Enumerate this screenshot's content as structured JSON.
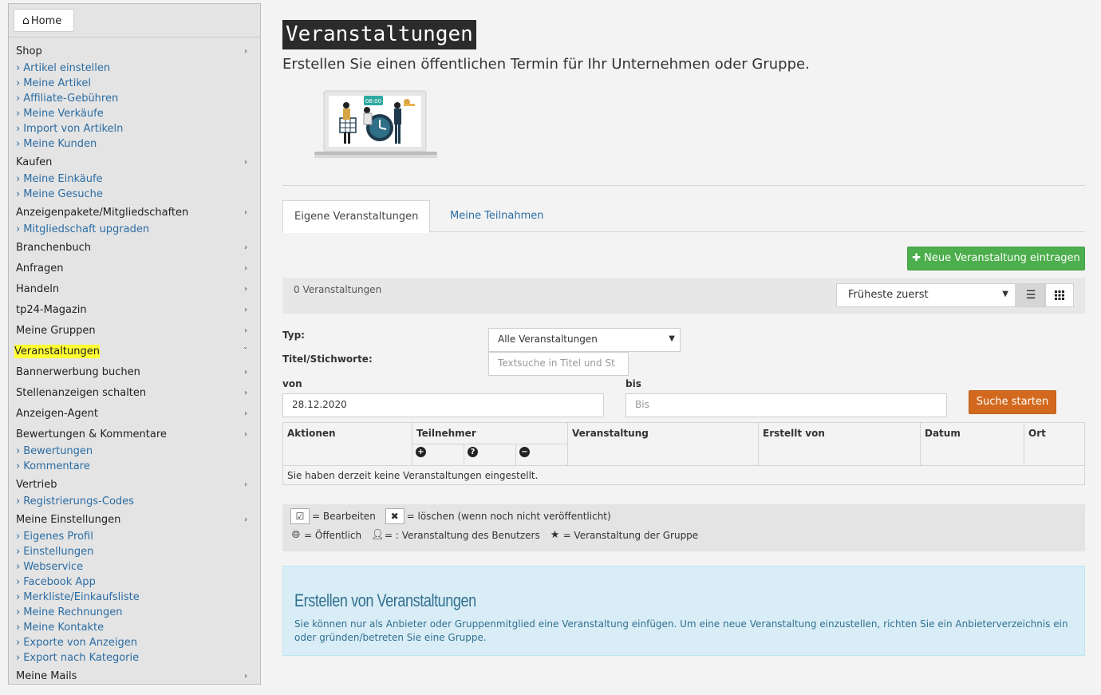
{
  "home": {
    "label": "Home",
    "icon": "home-icon"
  },
  "sidebar": {
    "rows": [
      {
        "type": "top",
        "label": "Shop"
      },
      {
        "type": "sub",
        "label": "Artikel einstellen"
      },
      {
        "type": "sub",
        "label": "Meine Artikel"
      },
      {
        "type": "sub",
        "label": "Affiliate-Gebühren"
      },
      {
        "type": "sub",
        "label": "Meine Verkäufe"
      },
      {
        "type": "sub",
        "label": "Import von Artikeln"
      },
      {
        "type": "sub",
        "label": "Meine Kunden"
      },
      {
        "type": "top",
        "label": "Kaufen"
      },
      {
        "type": "sub",
        "label": "Meine Einkäufe"
      },
      {
        "type": "sub",
        "label": "Meine Gesuche"
      },
      {
        "type": "top",
        "label": "Anzeigenpakete/Mitgliedschaften"
      },
      {
        "type": "sub",
        "label": "Mitgliedschaft upgraden"
      },
      {
        "type": "top",
        "label": "Branchenbuch"
      },
      {
        "type": "top",
        "label": "Anfragen"
      },
      {
        "type": "top",
        "label": "Handeln"
      },
      {
        "type": "top",
        "label": "tp24-Magazin"
      },
      {
        "type": "top",
        "label": "Meine Gruppen"
      },
      {
        "type": "top",
        "label": "Veranstaltungen",
        "active": true
      },
      {
        "type": "top",
        "label": "Bannerwerbung buchen"
      },
      {
        "type": "top",
        "label": "Stellenanzeigen schalten"
      },
      {
        "type": "top",
        "label": "Anzeigen-Agent"
      },
      {
        "type": "top",
        "label": "Bewertungen & Kommentare"
      },
      {
        "type": "sub",
        "label": "Bewertungen"
      },
      {
        "type": "sub",
        "label": "Kommentare"
      },
      {
        "type": "top",
        "label": "Vertrieb"
      },
      {
        "type": "sub",
        "label": "Registrierungs-Codes"
      },
      {
        "type": "top",
        "label": "Meine Einstellungen"
      },
      {
        "type": "sub",
        "label": "Eigenes Profil"
      },
      {
        "type": "sub",
        "label": "Einstellungen"
      },
      {
        "type": "sub",
        "label": "Webservice"
      },
      {
        "type": "sub",
        "label": "Facebook App"
      },
      {
        "type": "sub",
        "label": "Merkliste/Einkaufsliste"
      },
      {
        "type": "sub",
        "label": "Meine Rechnungen"
      },
      {
        "type": "sub",
        "label": "Meine Kontakte"
      },
      {
        "type": "sub",
        "label": "Exporte von Anzeigen"
      },
      {
        "type": "sub",
        "label": "Export nach Kategorie"
      },
      {
        "type": "top",
        "label": "Meine Mails"
      }
    ]
  },
  "page": {
    "title": "Veranstaltungen",
    "subtitle": "Erstellen Sie einen öffentlichen Termin für Ihr Unternehmen oder Gruppe.",
    "illustration_clock": "08:00"
  },
  "tabs": [
    {
      "label": "Eigene Veranstaltungen",
      "active": true
    },
    {
      "label": "Meine Teilnahmen",
      "active": false
    }
  ],
  "toolbar": {
    "new_button": "Neue Veranstaltung eintragen",
    "count": "0 Veranstaltungen",
    "sort_selected": "Früheste zuerst",
    "views": [
      "list-view-icon",
      "grid-view-icon"
    ]
  },
  "filters": {
    "type_label": "Typ:",
    "type_selected": "Alle Veranstaltungen",
    "keywords_label": "Titel/Stichworte:",
    "keywords_placeholder": "Textsuche in Titel und St",
    "from_label": "von",
    "from_value": "28.12.2020",
    "to_label": "bis",
    "to_placeholder": "Bis",
    "search_button": "Suche starten"
  },
  "table": {
    "columns": [
      "Aktionen",
      "Teilnehmer",
      "Veranstaltung",
      "Erstellt von",
      "Datum",
      "Ort"
    ],
    "participant_icons": [
      "plus-circle-icon",
      "question-circle-icon",
      "minus-circle-icon"
    ],
    "empty_text": "Sie haben derzeit keine Veranstaltungen eingestellt."
  },
  "legend": {
    "edit_icon": "☑",
    "edit": "= Bearbeiten",
    "delete_icon": "✖",
    "delete": "= löschen (wenn noch nicht veröffentlicht)",
    "public": "= Öffentlich",
    "user": "= : Veranstaltung des Benutzers",
    "group": "= Veranstaltung der Gruppe"
  },
  "info": {
    "heading": "Erstellen von Veranstaltungen",
    "text": "Sie können nur als Anbieter oder Gruppenmitglied eine Veranstaltung einfügen. Um eine neue Veranstaltung einzustellen, richten Sie ein Anbieterverzeichnis ein oder gründen/betreten Sie eine Gruppe."
  },
  "colors": {
    "link": "#2b6ca3",
    "highlight": "#ffff33",
    "new_button": "#4cae4c",
    "search_button": "#d2691e",
    "info_bg": "#d9edf7"
  }
}
